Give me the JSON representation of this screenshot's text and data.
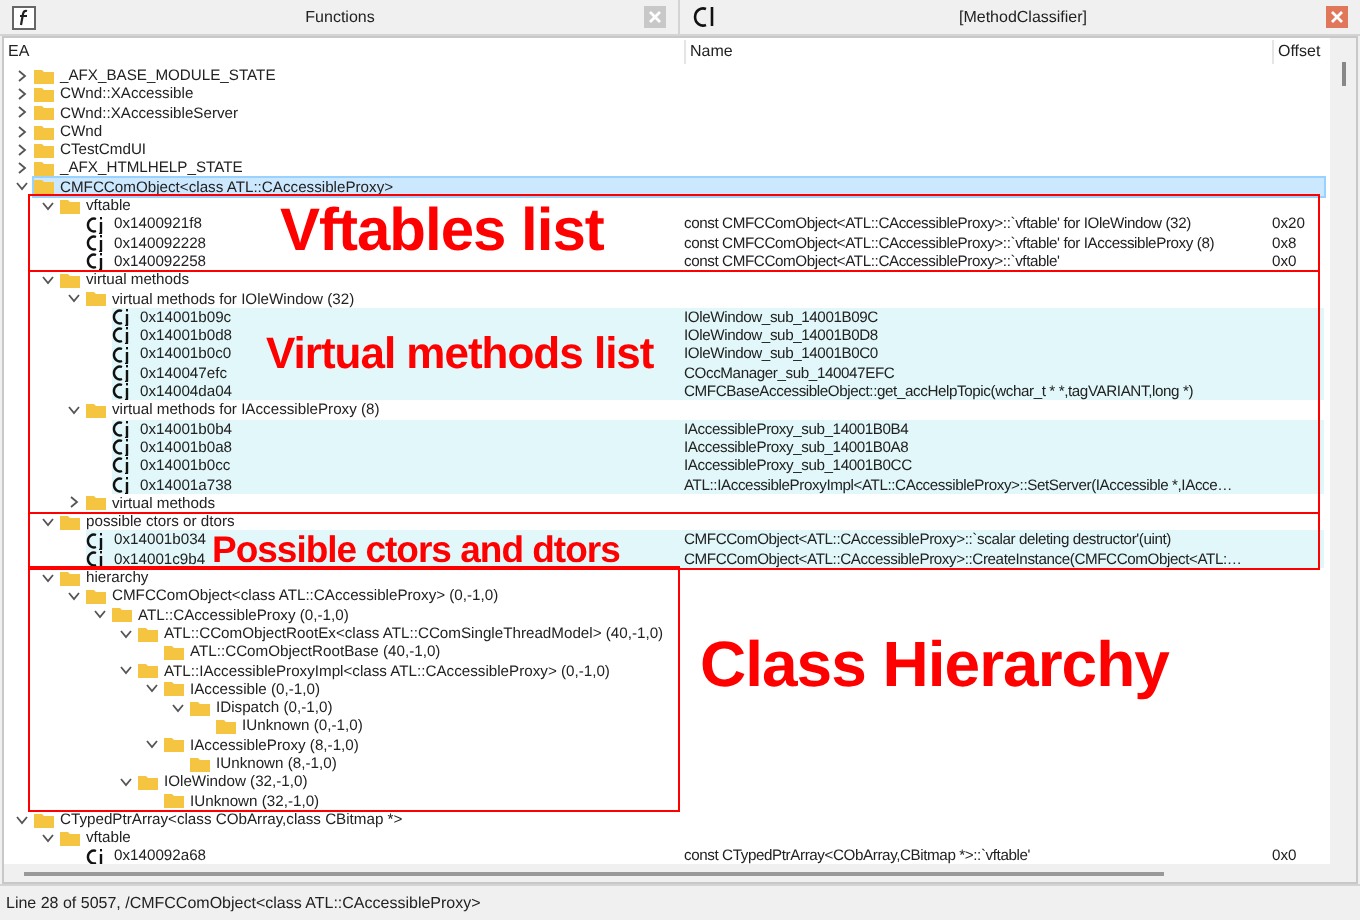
{
  "left_panel": {
    "title": "Functions"
  },
  "right_panel": {
    "title": "[MethodClassifier]"
  },
  "columns": [
    "EA",
    "Name",
    "Offset"
  ],
  "tree": [
    {
      "kind": "folder",
      "label": "_AFX_BASE_MODULE_STATE",
      "expanded": false,
      "selected": false
    },
    {
      "kind": "folder",
      "label": "CWnd::XAccessible",
      "expanded": false,
      "selected": false
    },
    {
      "kind": "folder",
      "label": "CWnd::XAccessibleServer",
      "expanded": false,
      "selected": false
    },
    {
      "kind": "folder",
      "label": "CWnd",
      "expanded": false,
      "selected": false
    },
    {
      "kind": "folder",
      "label": "CTestCmdUI",
      "expanded": false,
      "selected": false
    },
    {
      "kind": "folder",
      "label": "_AFX_HTMLHELP_STATE",
      "expanded": false,
      "selected": false
    },
    {
      "kind": "folder",
      "label": "CMFCComObject<class ATL::CAccessibleProxy>",
      "expanded": true,
      "selected": true,
      "children": [
        {
          "kind": "folder",
          "label": "vftable",
          "expanded": true,
          "selected": false,
          "children": [
            {
              "kind": "function",
              "ea": "0x1400921f8",
              "name": "const CMFCComObject<ATL::CAccessibleProxy>::`vftable' for IOleWindow (32)",
              "offset": "0x20",
              "highlighted": false,
              "selected": false
            },
            {
              "kind": "function",
              "ea": "0x140092228",
              "name": "const CMFCComObject<ATL::CAccessibleProxy>::`vftable' for IAccessibleProxy (8)",
              "offset": "0x8",
              "highlighted": false,
              "selected": false
            },
            {
              "kind": "function",
              "ea": "0x140092258",
              "name": "const CMFCComObject<ATL::CAccessibleProxy>::`vftable'",
              "offset": "0x0",
              "highlighted": false,
              "selected": false
            }
          ]
        },
        {
          "kind": "folder",
          "label": "virtual methods",
          "expanded": true,
          "selected": false,
          "children": [
            {
              "kind": "folder",
              "label": "virtual methods for IOleWindow (32)",
              "expanded": true,
              "selected": false,
              "children": [
                {
                  "kind": "function",
                  "ea": "0x14001b09c",
                  "name": "IOleWindow_sub_14001B09C",
                  "highlighted": true,
                  "selected": false
                },
                {
                  "kind": "function",
                  "ea": "0x14001b0d8",
                  "name": "IOleWindow_sub_14001B0D8",
                  "highlighted": true,
                  "selected": false
                },
                {
                  "kind": "function",
                  "ea": "0x14001b0c0",
                  "name": "IOleWindow_sub_14001B0C0",
                  "highlighted": true,
                  "selected": false
                },
                {
                  "kind": "function",
                  "ea": "0x140047efc",
                  "name": "COccManager_sub_140047EFC",
                  "highlighted": true,
                  "selected": false
                },
                {
                  "kind": "function",
                  "ea": "0x14004da04",
                  "name": "CMFCBaseAccessibleObject::get_accHelpTopic(wchar_t * *,tagVARIANT,long *)",
                  "highlighted": true,
                  "selected": false
                }
              ]
            },
            {
              "kind": "folder",
              "label": "virtual methods for IAccessibleProxy (8)",
              "expanded": true,
              "selected": false,
              "children": [
                {
                  "kind": "function",
                  "ea": "0x14001b0b4",
                  "name": "IAccessibleProxy_sub_14001B0B4",
                  "highlighted": true,
                  "selected": false
                },
                {
                  "kind": "function",
                  "ea": "0x14001b0a8",
                  "name": "IAccessibleProxy_sub_14001B0A8",
                  "highlighted": true,
                  "selected": false
                },
                {
                  "kind": "function",
                  "ea": "0x14001b0cc",
                  "name": "IAccessibleProxy_sub_14001B0CC",
                  "highlighted": true,
                  "selected": false
                },
                {
                  "kind": "function",
                  "ea": "0x14001a738",
                  "name": "ATL::IAccessibleProxyImpl<ATL::CAccessibleProxy>::SetServer(IAccessible *,IAcce…",
                  "highlighted": true,
                  "selected": false
                }
              ]
            },
            {
              "kind": "folder",
              "label": "virtual methods",
              "expanded": false,
              "selected": false
            }
          ]
        },
        {
          "kind": "folder",
          "label": "possible ctors or dtors",
          "expanded": true,
          "selected": false,
          "children": [
            {
              "kind": "function",
              "ea": "0x14001b034",
              "name": "CMFCComObject<ATL::CAccessibleProxy>::`scalar deleting destructor'(uint)",
              "highlighted": true,
              "selected": false
            },
            {
              "kind": "function",
              "ea": "0x14001c9b4",
              "name": "CMFCComObject<ATL::CAccessibleProxy>::CreateInstance(CMFCComObject<ATL:…",
              "highlighted": true,
              "selected": false
            }
          ]
        },
        {
          "kind": "folder",
          "label": "hierarchy",
          "expanded": true,
          "selected": false,
          "children": [
            {
              "kind": "folder",
              "label": "CMFCComObject<class ATL::CAccessibleProxy> (0,-1,0)",
              "expanded": true,
              "selected": false,
              "children": [
                {
                  "kind": "folder",
                  "label": "ATL::CAccessibleProxy (0,-1,0)",
                  "expanded": true,
                  "selected": false,
                  "children": [
                    {
                      "kind": "folder",
                      "label": "ATL::CComObjectRootEx<class ATL::CComSingleThreadModel> (40,-1,0)",
                      "expanded": true,
                      "selected": false,
                      "children": [
                        {
                          "kind": "folder",
                          "label": "ATL::CComObjectRootBase (40,-1,0)",
                          "selected": false
                        }
                      ]
                    },
                    {
                      "kind": "folder",
                      "label": "ATL::IAccessibleProxyImpl<class ATL::CAccessibleProxy> (0,-1,0)",
                      "expanded": true,
                      "selected": false,
                      "children": [
                        {
                          "kind": "folder",
                          "label": "IAccessible (0,-1,0)",
                          "expanded": true,
                          "selected": false,
                          "children": [
                            {
                              "kind": "folder",
                              "label": "IDispatch (0,-1,0)",
                              "expanded": true,
                              "selected": false,
                              "children": [
                                {
                                  "kind": "folder",
                                  "label": "IUnknown (0,-1,0)",
                                  "selected": false
                                }
                              ]
                            }
                          ]
                        },
                        {
                          "kind": "folder",
                          "label": "IAccessibleProxy (8,-1,0)",
                          "expanded": true,
                          "selected": false,
                          "children": [
                            {
                              "kind": "folder",
                              "label": "IUnknown (8,-1,0)",
                              "selected": false
                            }
                          ]
                        }
                      ]
                    },
                    {
                      "kind": "folder",
                      "label": "IOleWindow (32,-1,0)",
                      "expanded": true,
                      "selected": false,
                      "children": [
                        {
                          "kind": "folder",
                          "label": "IUnknown (32,-1,0)",
                          "selected": false
                        }
                      ]
                    }
                  ]
                }
              ]
            }
          ]
        }
      ]
    },
    {
      "kind": "folder",
      "label": "CTypedPtrArray<class CObArray,class CBitmap *>",
      "expanded": true,
      "selected": false,
      "children": [
        {
          "kind": "folder",
          "label": "vftable",
          "expanded": true,
          "selected": false,
          "children": [
            {
              "kind": "function",
              "ea": "0x140092a68",
              "name": "const CTypedPtrArray<CObArray,CBitmap *>::`vftable'",
              "offset": "0x0",
              "highlighted": false,
              "selected": false
            }
          ]
        }
      ]
    }
  ],
  "annotations": [
    {
      "label": "Vftables list"
    },
    {
      "label": "Virtual methods list"
    },
    {
      "label": "Possible ctors and dtors"
    },
    {
      "label": "Class Hierarchy"
    }
  ],
  "status_bar": "Line 28 of 5057, /CMFCComObject<class ATL::CAccessibleProxy>"
}
